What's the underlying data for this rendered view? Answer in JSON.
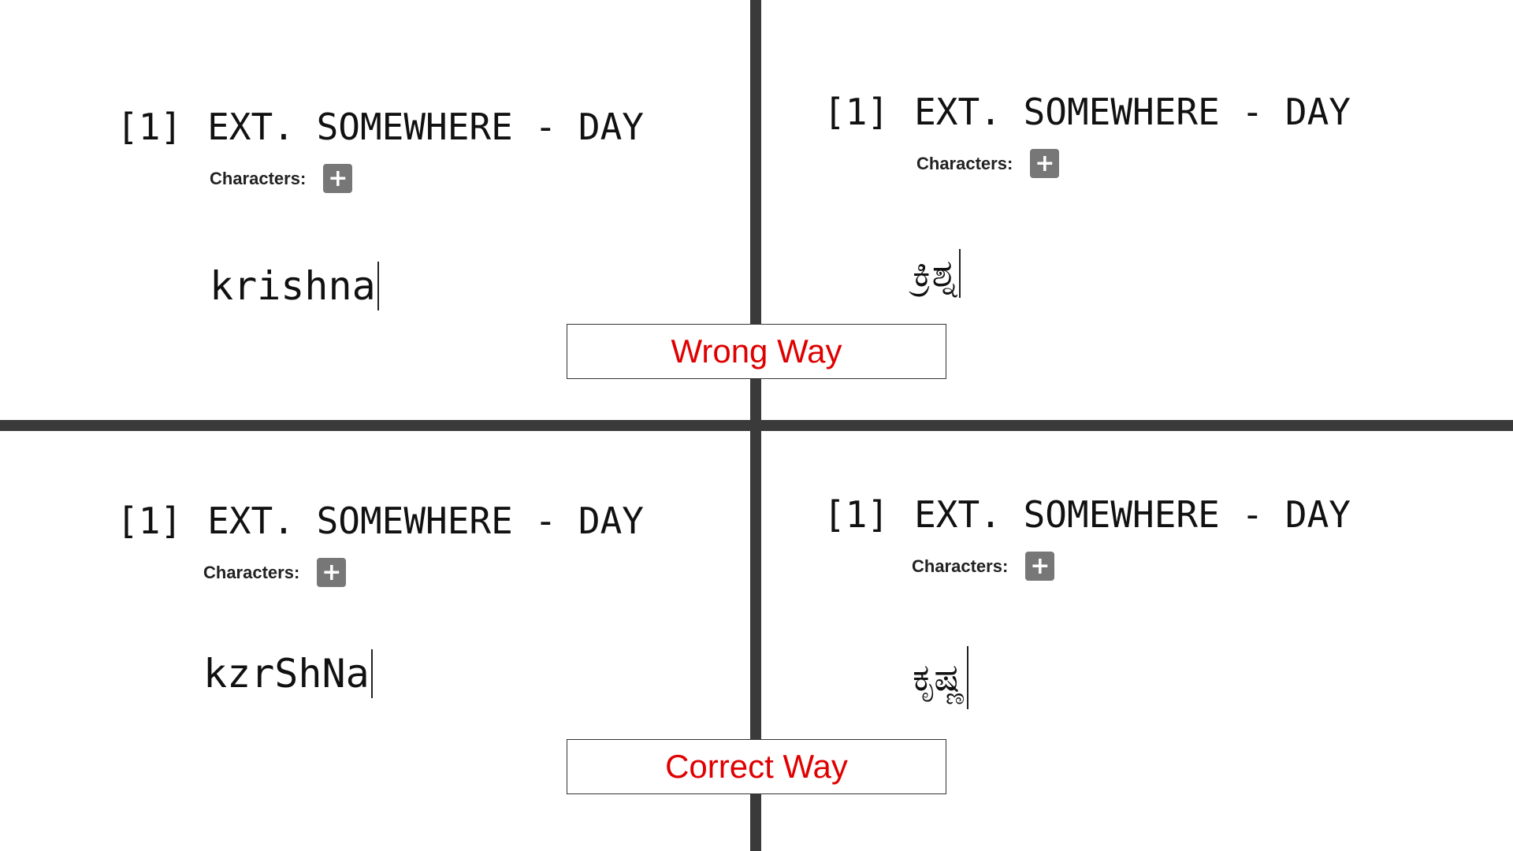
{
  "panels": [
    {
      "heading_num": "[1]",
      "heading_text": "EXT. SOMEWHERE - DAY",
      "characters_label": "Characters:",
      "add_symbol": "+",
      "typed_text": "krishna"
    },
    {
      "heading_num": "[1]",
      "heading_text": "EXT. SOMEWHERE - DAY",
      "characters_label": "Characters:",
      "add_symbol": "+",
      "typed_text": "ಕ್ರಿಶ್ನ"
    },
    {
      "heading_num": "[1]",
      "heading_text": "EXT. SOMEWHERE - DAY",
      "characters_label": "Characters:",
      "add_symbol": "+",
      "typed_text": "kzrShNa"
    },
    {
      "heading_num": "[1]",
      "heading_text": "EXT. SOMEWHERE - DAY",
      "characters_label": "Characters:",
      "add_symbol": "+",
      "typed_text": "ಕೃಷ್ಣ"
    }
  ],
  "labels": {
    "wrong": "Wrong Way",
    "correct": "Correct Way"
  },
  "colors": {
    "divider": "#3a3a3a",
    "label_text": "#e00000",
    "add_button": "#777777"
  }
}
